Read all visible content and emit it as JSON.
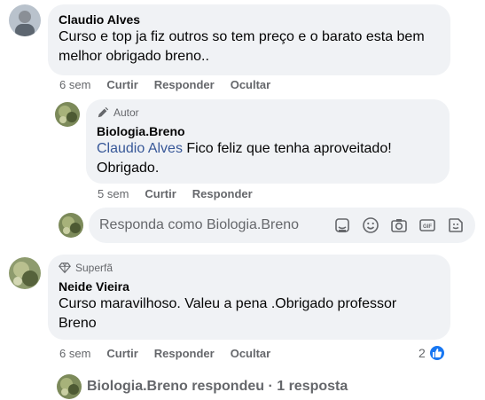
{
  "colors": {
    "bubble": "#f0f2f5",
    "meta": "#65676b",
    "mention": "#385898",
    "like": "#1877f2"
  },
  "comment1": {
    "author": "Claudio Alves",
    "text": "Curso e top ja fiz outros so tem preço e o barato esta bem melhor obrigado breno..",
    "time": "6 sem",
    "like": "Curtir",
    "reply": "Responder",
    "hide": "Ocultar"
  },
  "reply1": {
    "badge": "Autor",
    "badge_icon": "pencil-icon",
    "author": "Biologia.Breno",
    "mention": "Claudio Alves",
    "text": " Fico feliz que tenha aproveitado! Obrigado.",
    "time": "5 sem",
    "like": "Curtir",
    "reply": "Responder"
  },
  "composer": {
    "placeholder": "Responda como Biologia.Breno",
    "tools": [
      "sticker-icon",
      "emoji-icon",
      "camera-icon",
      "gif-icon",
      "avatar-sticker-icon"
    ]
  },
  "comment2": {
    "badge": "Superfã",
    "badge_icon": "diamond-icon",
    "author": "Neide Vieira",
    "text": "Curso maravilhoso. Valeu a pena .Obrigado professor Breno",
    "time": "6 sem",
    "like": "Curtir",
    "reply": "Responder",
    "hide": "Ocultar",
    "reaction_count": "2"
  },
  "replies_summary": {
    "text": "Biologia.Breno respondeu · 1 resposta"
  }
}
